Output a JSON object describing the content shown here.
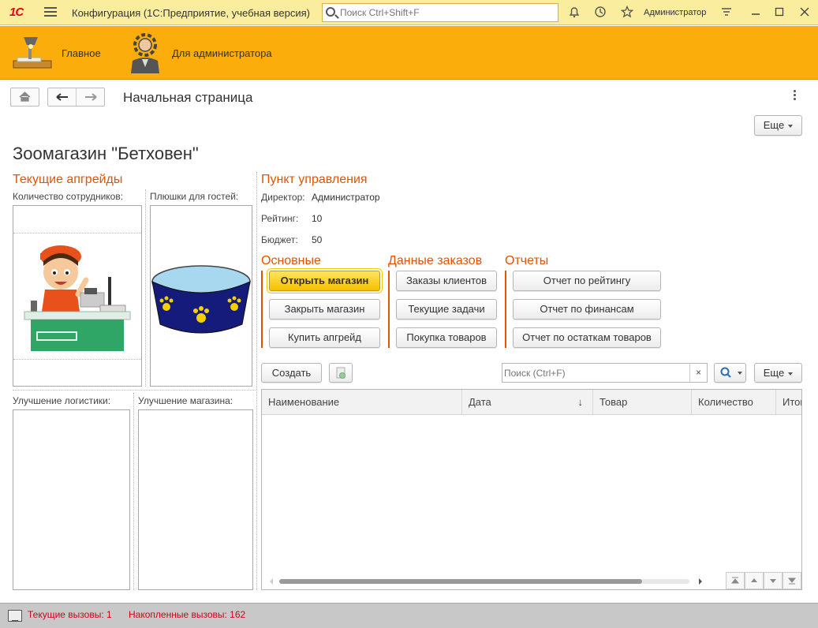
{
  "titlebar": {
    "logo": "1С",
    "title": "Конфигурация  (1С:Предприятие, учебная версия)",
    "search_placeholder": "Поиск Ctrl+Shift+F",
    "user": "Администратор"
  },
  "sections": [
    {
      "label": "Главное",
      "icon": "desk-lamp-icon"
    },
    {
      "label": "Для администратора",
      "icon": "admin-gear-icon"
    }
  ],
  "nav": {
    "page_title": "Начальная страница"
  },
  "form": {
    "more_label": "Еще",
    "title": "Зоомагазин \"Бетховен\"",
    "upgrades": {
      "heading": "Текущие апгрейды",
      "staff_label": "Количество сотрудников:",
      "treats_label": "Плюшки для гостей:",
      "logistics_label": "Улучшение логистики:",
      "store_label": "Улучшение магазина:"
    },
    "control": {
      "heading": "Пункт управления",
      "director_label": "Директор:",
      "director_value": "Администратор",
      "rating_label": "Рейтинг:",
      "rating_value": "10",
      "budget_label": "Бюджет:",
      "budget_value": "50"
    },
    "main_group": {
      "heading": "Основные",
      "open": "Открыть магазин",
      "close": "Закрыть магазин",
      "buy": "Купить апгрейд"
    },
    "orders_group": {
      "heading": "Данные заказов",
      "client_orders": "Заказы клиентов",
      "current_tasks": "Текущие задачи",
      "purchase": "Покупка товаров"
    },
    "reports_group": {
      "heading": "Отчеты",
      "rating_report": "Отчет по рейтингу",
      "finance_report": "Отчет по финансам",
      "stock_report": "Отчет по остаткам товаров"
    },
    "table": {
      "create": "Создать",
      "search_placeholder": "Поиск (Ctrl+F)",
      "clear": "×",
      "more_label": "Еще",
      "columns": [
        "Наименование",
        "Дата",
        "Товар",
        "Количество",
        "Итог"
      ],
      "sort_marker": "↓"
    }
  },
  "status": {
    "current_calls": "Текущие вызовы: 1",
    "accumulated_calls": "Накопленные вызовы: 162"
  },
  "colors": {
    "titlebar": "#fbed9e",
    "sections": "#fbad0b",
    "accent": "#e35300",
    "primary_button": "#f5c000",
    "status_text": "#d0021b"
  }
}
